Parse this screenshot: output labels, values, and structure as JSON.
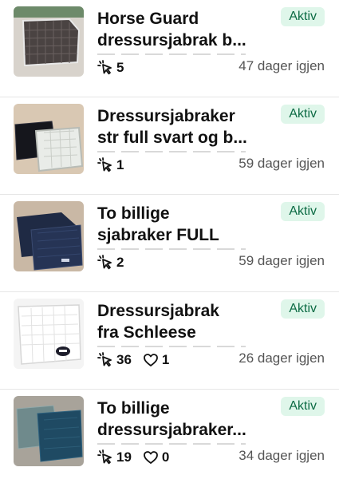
{
  "listings": [
    {
      "title_line1": "Horse Guard",
      "title_line2": "dressursjabrak b...",
      "status": "Aktiv",
      "clicks": "5",
      "likes": "",
      "days_left": "47 dager igjen"
    },
    {
      "title_line1": "Dressursjabraker",
      "title_line2": "str full svart og b...",
      "status": "Aktiv",
      "clicks": "1",
      "likes": "",
      "days_left": "59 dager igjen"
    },
    {
      "title_line1": "To billige",
      "title_line2": "sjabraker FULL",
      "status": "Aktiv",
      "clicks": "2",
      "likes": "",
      "days_left": "59 dager igjen"
    },
    {
      "title_line1": "Dressursjabrak",
      "title_line2": "fra Schleese",
      "status": "Aktiv",
      "clicks": "36",
      "likes": "1",
      "days_left": "26 dager igjen"
    },
    {
      "title_line1": "To billige",
      "title_line2": "dressursjabraker...",
      "status": "Aktiv",
      "clicks": "19",
      "likes": "0",
      "days_left": "34 dager igjen"
    }
  ],
  "icons": {
    "clicks": "cursor-click-icon",
    "likes": "heart-icon"
  },
  "colors": {
    "badge_bg": "#dff6ea",
    "badge_text": "#0c6b44",
    "divider": "#e6e6e6"
  }
}
